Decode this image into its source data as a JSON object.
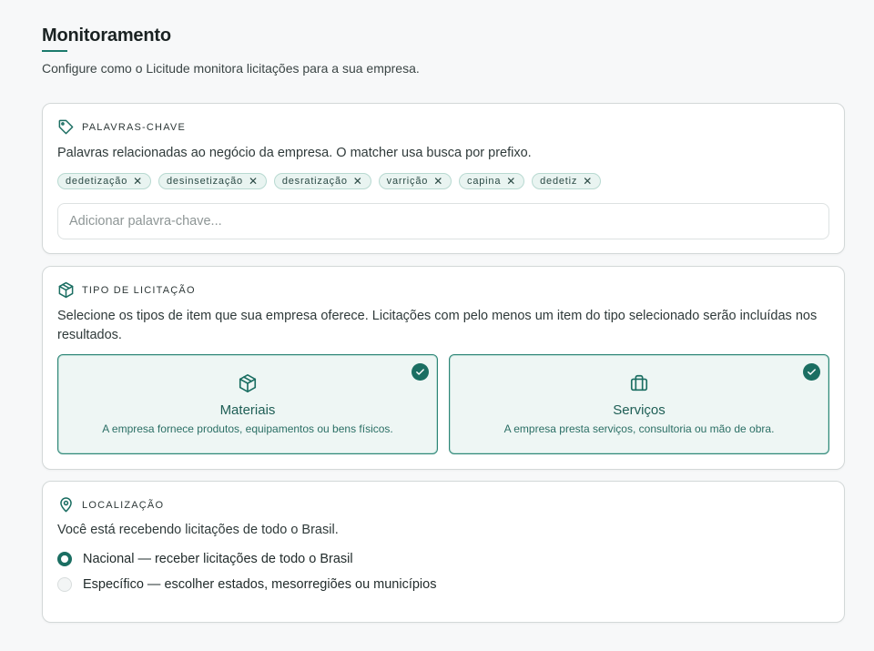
{
  "header": {
    "title": "Monitoramento",
    "subtitle": "Configure como o Licitude monitora licitações para a sua empresa."
  },
  "keywords": {
    "label": "PALAVRAS-CHAVE",
    "icon": "tag-icon",
    "description": "Palavras relacionadas ao negócio da empresa. O matcher usa busca por prefixo.",
    "chips": [
      "dedetização",
      "desinsetização",
      "desratização",
      "varrição",
      "capina",
      "dedetiz"
    ],
    "input_placeholder": "Adicionar palavra-chave...",
    "input_value": ""
  },
  "tipo": {
    "label": "TIPO DE LICITAÇÃO",
    "icon": "box-icon",
    "description": "Selecione os tipos de item que sua empresa oferece. Licitações com pelo menos um item do tipo selecionado serão incluídas nos resultados.",
    "options": [
      {
        "title": "Materiais",
        "desc": "A empresa fornece produtos, equipamentos ou bens físicos.",
        "icon": "box-icon",
        "selected": true
      },
      {
        "title": "Serviços",
        "desc": "A empresa presta serviços, consultoria ou mão de obra.",
        "icon": "briefcase-icon",
        "selected": true
      }
    ]
  },
  "localizacao": {
    "label": "LOCALIZAÇÃO",
    "icon": "map-pin-icon",
    "description": "Você está recebendo licitações de todo o Brasil.",
    "options": [
      {
        "label": "Nacional — receber licitações de todo o Brasil",
        "selected": true
      },
      {
        "label": "Específico — escolher estados, mesorregiões ou municípios",
        "selected": false
      }
    ]
  },
  "colors": {
    "accent": "#1b6e62",
    "selected_bg": "#eef6f4",
    "chip_bg": "#e9f4f1"
  }
}
